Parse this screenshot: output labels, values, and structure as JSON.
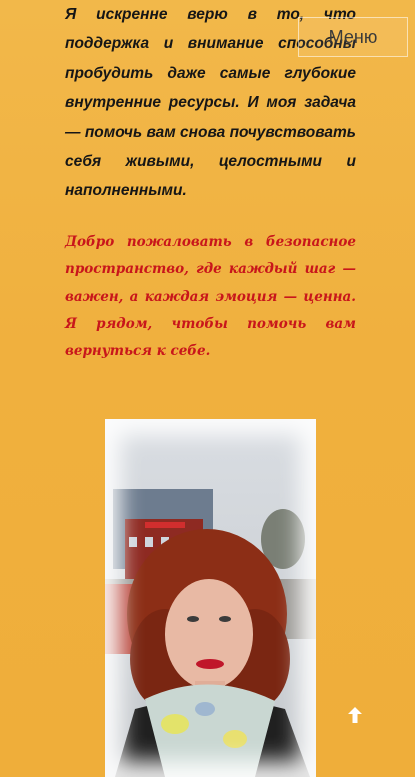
{
  "header": {
    "menu_label": "Меню"
  },
  "content": {
    "paragraph_main": "Я искренне верю в то, что поддержка и внимание способны пробудить даже самые глубокие внутренние ресурсы. И моя задача — помочь вам снова почувствовать себя живыми, целостными и наполненными.",
    "paragraph_welcome": "Добро пожаловать в безопасное пространство, где каждый шаг — важен, а каждая эмоция — ценна. Я рядом, чтобы помочь вам вернуться к себе."
  },
  "colors": {
    "background": "#f0b03e",
    "body_text": "#161616",
    "accent_text": "#c8161b"
  },
  "icons": {
    "scroll_top": "arrow-up-icon"
  }
}
